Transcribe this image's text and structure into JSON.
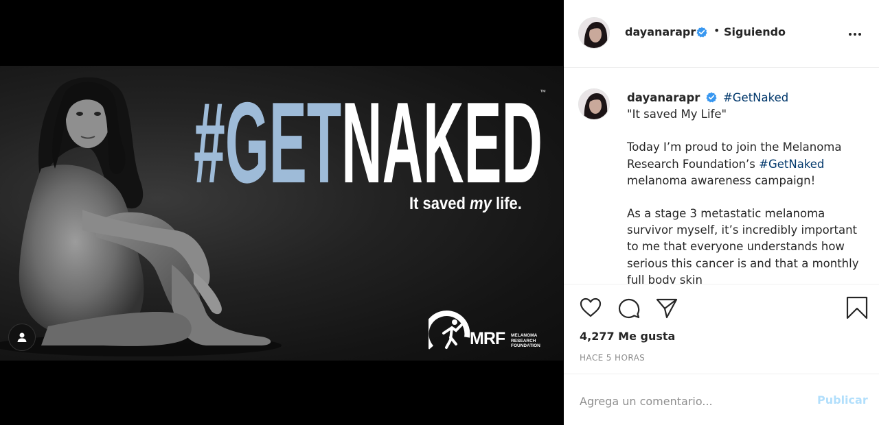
{
  "post": {
    "username": "dayanarapr",
    "follow_status": "Siguiendo",
    "dot": "•",
    "verified": true
  },
  "ad": {
    "headline_hash": "#GET",
    "headline_word": "NAKED",
    "trademark": "™",
    "tagline_before": "It saved ",
    "tagline_em": "my",
    "tagline_after": " life.",
    "logo_letters": "MRF",
    "logo_lines": [
      "MELANOMA",
      "RESEARCH",
      "FOUNDATION"
    ],
    "colors": {
      "hash_blue": "#9ebbd8",
      "white": "#ffffff"
    }
  },
  "caption": {
    "username": "dayanarapr",
    "hashtag": "#GetNaked",
    "line1": "\"It saved My Life\"",
    "para2_before": "Today I’m proud to join the Melanoma Research Foundation’s ",
    "para2_tag": "#GetNaked",
    "para2_after": " melanoma awareness campaign!",
    "para3": "As a stage 3 metastatic melanoma survivor myself, it’s incredibly important to me that everyone understands how serious this cancer is and that a monthly full body skin"
  },
  "actions": {
    "like_icon": "heart-icon",
    "comment_icon": "comment-icon",
    "share_icon": "share-icon",
    "save_icon": "bookmark-icon"
  },
  "likes_text": "4,277 Me gusta",
  "time_text": "HACE 5 HORAS",
  "comment": {
    "placeholder": "Agrega un comentario...",
    "publish_label": "Publicar"
  },
  "colors": {
    "link": "#00376b",
    "verified": "#3897f0",
    "publish_disabled": "#b2dffc"
  }
}
